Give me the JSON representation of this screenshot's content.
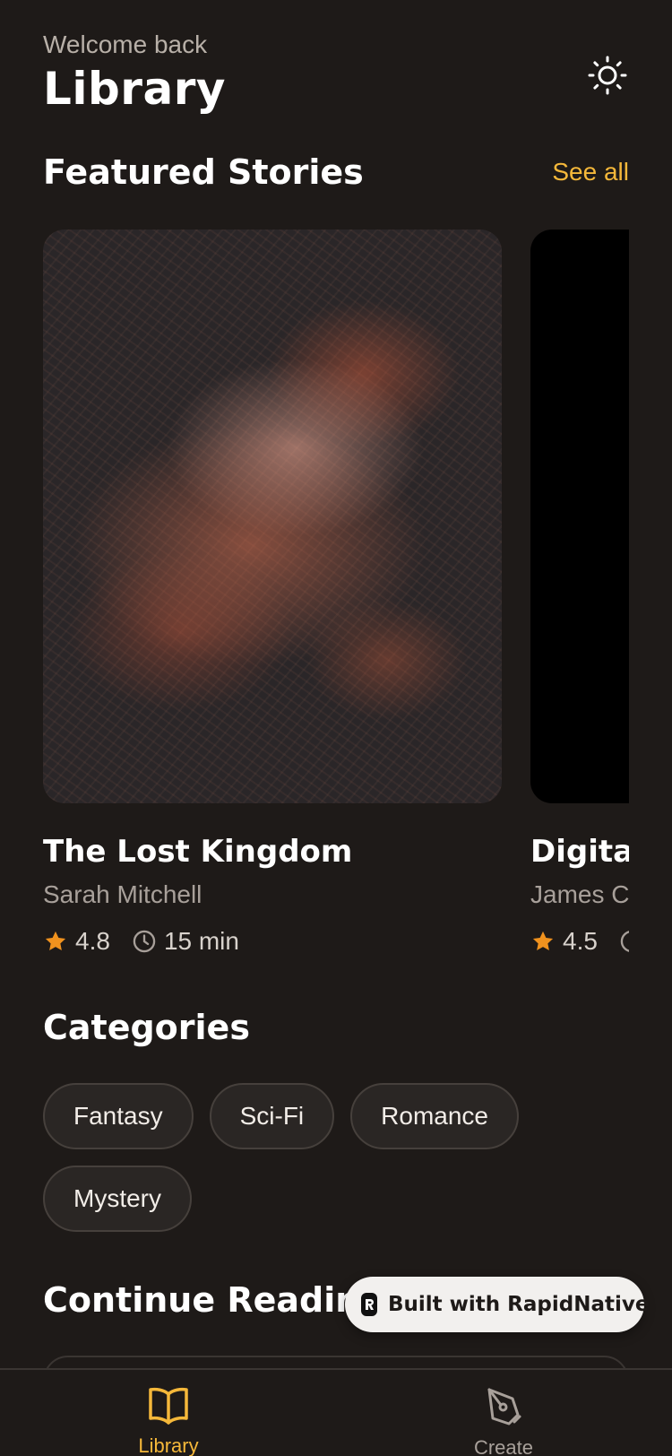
{
  "header": {
    "welcome": "Welcome back",
    "title": "Library",
    "theme_icon": "sun-icon"
  },
  "featured": {
    "title": "Featured Stories",
    "see_all": "See all",
    "stories": [
      {
        "title": "The Lost Kingdom",
        "author": "Sarah Mitchell",
        "rating": "4.8",
        "duration": "15 min",
        "image": "city-lights-aerial"
      },
      {
        "title": "Digital",
        "author": "James Ch",
        "rating": "4.5",
        "duration": "",
        "image": "dark"
      }
    ]
  },
  "categories": {
    "title": "Categories",
    "items": [
      "Fantasy",
      "Sci-Fi",
      "Romance",
      "Mystery"
    ]
  },
  "continue_reading": {
    "title": "Continue Reading"
  },
  "badge": {
    "text": "Built with RapidNative",
    "logo_letter": "R"
  },
  "tabbar": {
    "items": [
      {
        "label": "Library",
        "icon": "book-open-icon",
        "active": true
      },
      {
        "label": "Create",
        "icon": "pen-nib-icon",
        "active": false
      }
    ]
  },
  "colors": {
    "background": "#1e1a18",
    "accent": "#f5b83a",
    "star": "#f0921e",
    "muted": "#a8a09a"
  }
}
